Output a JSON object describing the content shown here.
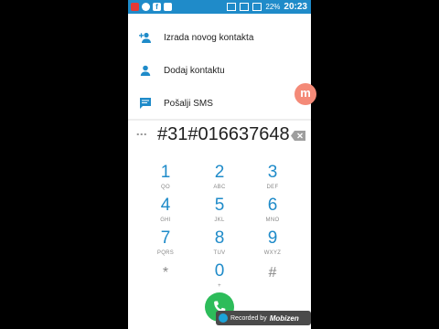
{
  "status_bar": {
    "battery": "22%",
    "time": "20:23"
  },
  "menu": {
    "items": [
      {
        "label": "Izrada novog kontakta",
        "icon": "add-person-icon"
      },
      {
        "label": "Dodaj kontaktu",
        "icon": "person-icon"
      },
      {
        "label": "Pošalji SMS",
        "icon": "message-icon"
      }
    ]
  },
  "dialer": {
    "number": "#31#016637648",
    "keys": [
      {
        "digit": "1",
        "letters": "QO"
      },
      {
        "digit": "2",
        "letters": "ABC"
      },
      {
        "digit": "3",
        "letters": "DEF"
      },
      {
        "digit": "4",
        "letters": "GHI"
      },
      {
        "digit": "5",
        "letters": "JKL"
      },
      {
        "digit": "6",
        "letters": "MNO"
      },
      {
        "digit": "7",
        "letters": "PQRS"
      },
      {
        "digit": "8",
        "letters": "TUV"
      },
      {
        "digit": "9",
        "letters": "WXYZ"
      },
      {
        "digit": "*",
        "letters": ""
      },
      {
        "digit": "0",
        "letters": "+"
      },
      {
        "digit": "#",
        "letters": ""
      }
    ]
  },
  "floating_button": {
    "label": "m"
  },
  "watermark": {
    "prefix": "Recorded by",
    "brand": "Mobizen"
  },
  "colors": {
    "accent": "#1f8bc9",
    "call": "#2dbc5a"
  }
}
